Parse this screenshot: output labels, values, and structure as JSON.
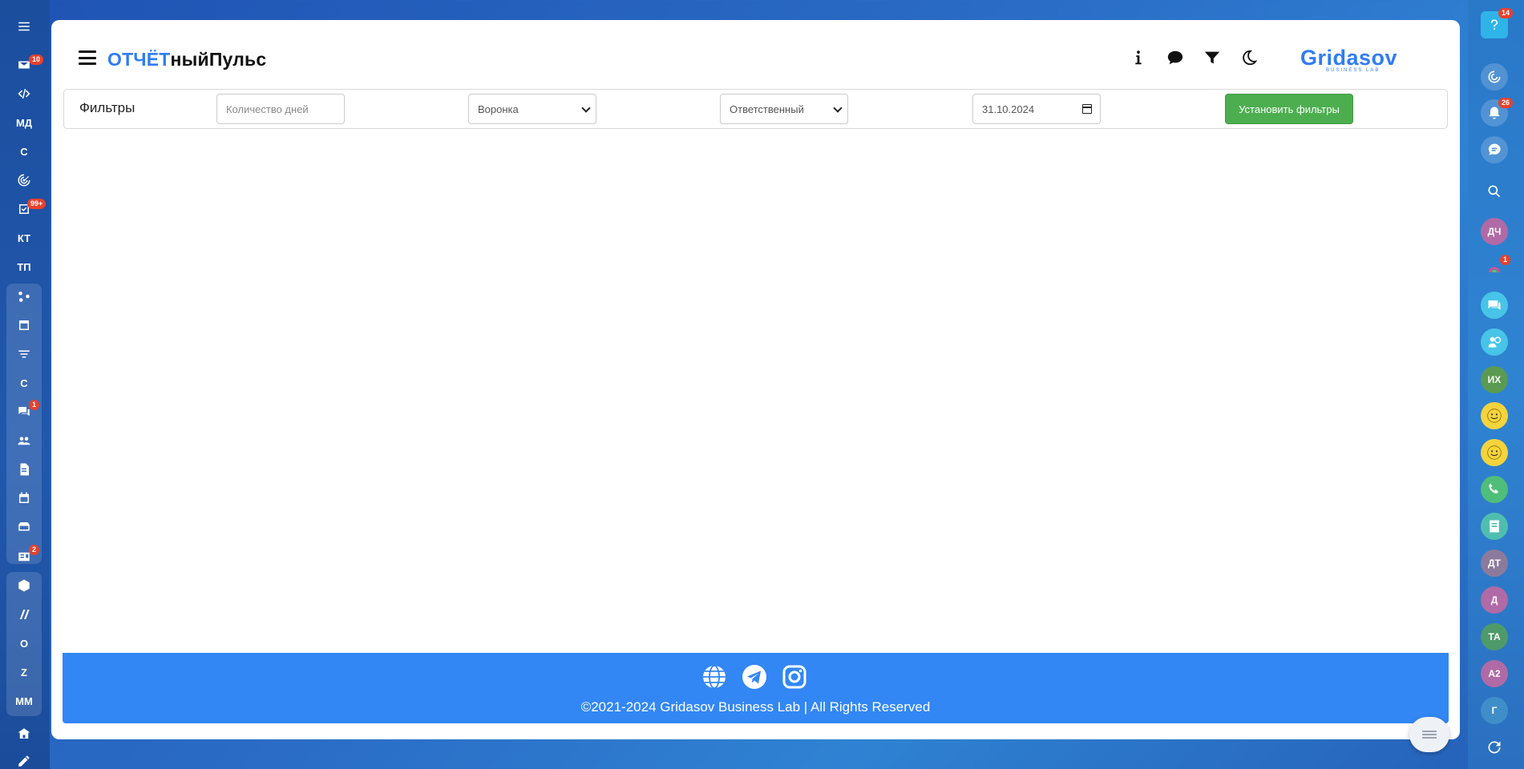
{
  "left_rail": {
    "items": [
      {
        "name": "menu-icon",
        "text": ""
      },
      {
        "name": "mail-icon",
        "text": "",
        "badge": "10"
      },
      {
        "name": "code-icon",
        "text": ""
      },
      {
        "name": "rail-md",
        "text": "МД"
      },
      {
        "name": "rail-c",
        "text": "С"
      },
      {
        "name": "target-icon",
        "text": ""
      },
      {
        "name": "task-icon",
        "text": "",
        "badge": "99+"
      },
      {
        "name": "rail-kt",
        "text": "КТ"
      },
      {
        "name": "rail-tp",
        "text": "ТП"
      },
      {
        "name": "share-icon",
        "text": ""
      },
      {
        "name": "window-icon",
        "text": ""
      },
      {
        "name": "filter-icon",
        "text": ""
      },
      {
        "name": "rail-c2",
        "text": "С"
      },
      {
        "name": "chat-icon",
        "text": "",
        "badge": "1"
      },
      {
        "name": "group-icon",
        "text": ""
      },
      {
        "name": "document-icon",
        "text": ""
      },
      {
        "name": "calendar-icon",
        "text": ""
      },
      {
        "name": "storage-icon",
        "text": ""
      },
      {
        "name": "contact-card-icon",
        "text": "",
        "badge": "2"
      },
      {
        "name": "cube-icon",
        "text": ""
      },
      {
        "name": "slashes-icon",
        "text": ""
      },
      {
        "name": "rail-o",
        "text": "О"
      },
      {
        "name": "rail-z",
        "text": "Z"
      },
      {
        "name": "rail-mm",
        "text": "ММ"
      },
      {
        "name": "house-icon",
        "text": ""
      },
      {
        "name": "pen-icon",
        "text": ""
      }
    ]
  },
  "right_rail": {
    "help_badge": "14",
    "bell_badge": "26",
    "rainbow_badge": "1",
    "avatars": [
      "ДЧ",
      "ИХ",
      "ДТ",
      "Д",
      "ТА",
      "А2",
      "Г"
    ]
  },
  "header": {
    "title_part1": "ОТЧЁТ",
    "title_part2": "ныйПульс",
    "brand": "Gridasov",
    "brand_sub": "BUSINESS LAB"
  },
  "filters": {
    "title": "Фильтры",
    "days_placeholder": "Количество дней",
    "funnel_selected": "Воронка",
    "responsible_selected": "Ответственный",
    "date_value": "31.10.2024",
    "apply_label": "Установить фильтры"
  },
  "footer": {
    "copyright": "©2021-2024 Gridasov Business Lab | All Rights Reserved"
  },
  "colors": {
    "accent": "#2f7cf6",
    "apply": "#4cae4f",
    "footer": "#3287f5",
    "badge": "#e8412c"
  }
}
